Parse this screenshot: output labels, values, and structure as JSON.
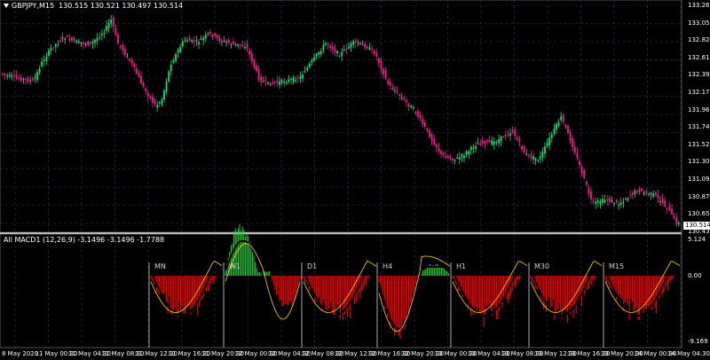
{
  "main_header": {
    "symbol": "GBPJPY,M15",
    "ohlc": "130.515 130.521 130.497 130.514"
  },
  "indicator_header": "All MACD1 (12,26,9) -3.1496 -3.1496 -1.7788",
  "price_axis": {
    "labels": [
      "133.265",
      "133.050",
      "132.825",
      "132.610",
      "132.395",
      "132.175",
      "131.960",
      "131.740",
      "131.525",
      "131.305",
      "131.090",
      "130.870",
      "130.655",
      "130.435"
    ],
    "current_price": "130.514"
  },
  "indicator_axis": {
    "labels": [
      "5.124",
      "0.00",
      "-9.169"
    ]
  },
  "time_axis": {
    "labels": [
      "8 May 2020",
      "11 May 00:30",
      "11 May 04:30",
      "11 May 08:30",
      "11 May 12:30",
      "11 May 16:30",
      "11 May 20:30",
      "12 May 00:30",
      "12 May 04:30",
      "12 May 08:30",
      "12 May 12:30",
      "12 May 16:30",
      "12 May 20:30",
      "13 May 00:30",
      "13 May 04:30",
      "13 May 08:30",
      "13 May 12:30",
      "13 May 16:30",
      "13 May 20:30",
      "14 May 00:30",
      "14 May 04:30"
    ]
  },
  "timeframe_panels": [
    "MN",
    "W1",
    "D1",
    "H4",
    "H1",
    "M30",
    "M15"
  ],
  "colors": {
    "background": "#000000",
    "bull_candle": "#00e676",
    "bear_candle": "#ff1493",
    "neutral_candle": "#9e9e9e",
    "grid": "#2a3a5a",
    "macd_negative": "#ff0000",
    "macd_positive": "#2ecc40",
    "signal_line": "#ffd700",
    "macd_line": "#000000"
  }
}
